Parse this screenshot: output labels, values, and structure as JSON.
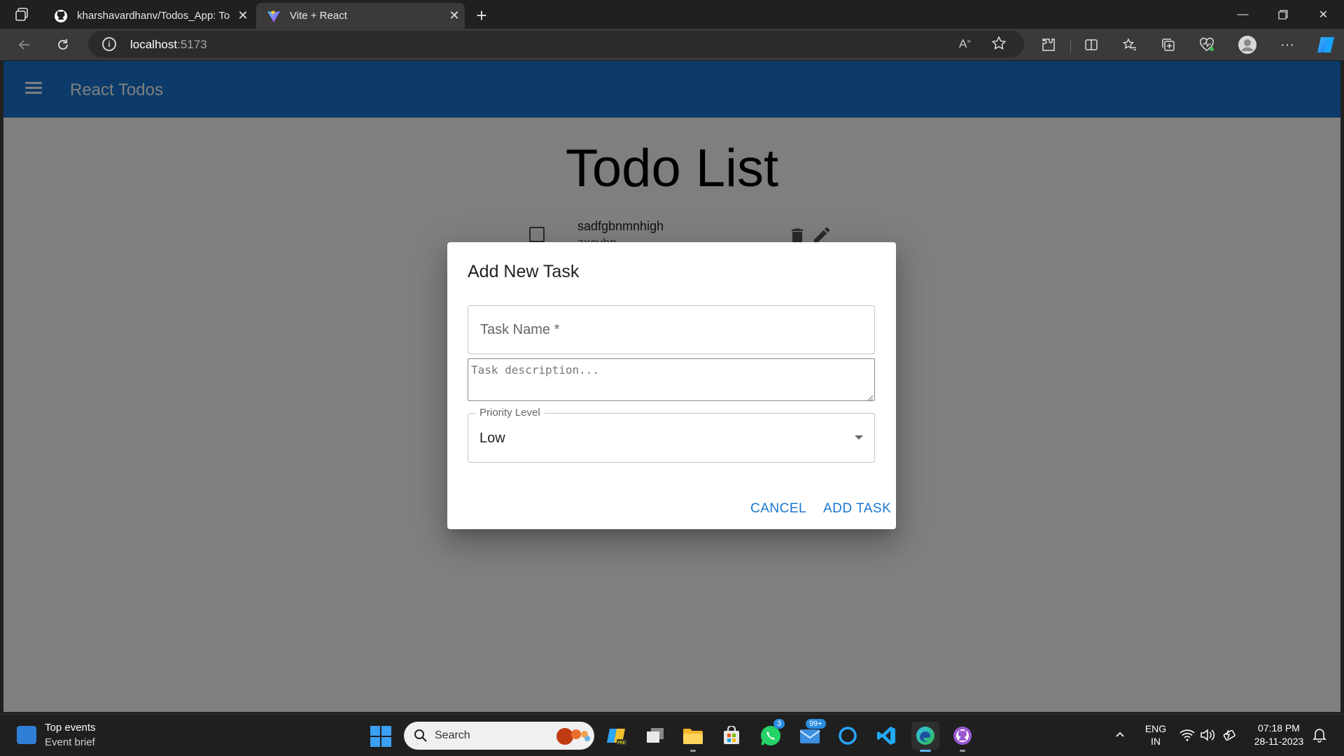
{
  "browser": {
    "tabs": [
      {
        "title": "kharshavardhanv/Todos_App: To",
        "icon": "github-icon"
      },
      {
        "title": "Vite + React",
        "icon": "vite-icon"
      }
    ],
    "url_host": "localhost",
    "url_port": ":5173"
  },
  "app": {
    "title": "React Todos",
    "heading": "Todo List",
    "todo": {
      "name": "sadfgbnmnhigh",
      "description": "zxcvbn"
    }
  },
  "dialog": {
    "title": "Add New Task",
    "task_name_placeholder": "Task Name *",
    "description_placeholder": "Task description...",
    "priority_label": "Priority Level",
    "priority_value": "Low",
    "cancel_label": "CANCEL",
    "add_label": "ADD TASK"
  },
  "taskbar": {
    "widget_title": "Top events",
    "widget_subtitle": "Event brief",
    "search_label": "Search",
    "whatsapp_badge": "3",
    "mail_badge": "99+",
    "lang_line1": "ENG",
    "lang_line2": "IN",
    "time": "07:18 PM",
    "date": "28-11-2023"
  },
  "colors": {
    "app_bar": "#1976d2",
    "primary_text": "#1976d2",
    "browser_dark": "#202020"
  }
}
